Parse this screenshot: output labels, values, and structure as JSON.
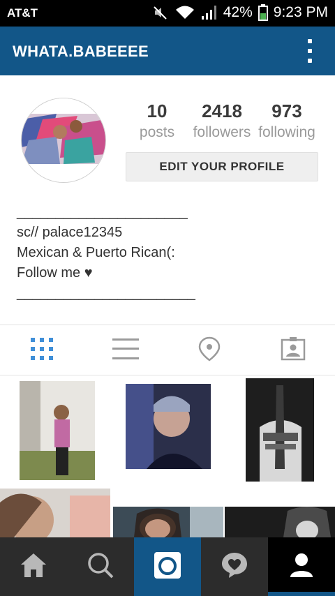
{
  "status_bar": {
    "carrier": "AT&T",
    "battery": "42%",
    "time": "9:23 PM"
  },
  "app_bar": {
    "title": "WHATA.BABEEEE",
    "menu_icon": "overflow-menu-icon",
    "color": "#125688"
  },
  "profile": {
    "stats": [
      {
        "value": "10",
        "label": "posts"
      },
      {
        "value": "2418",
        "label": "followers"
      },
      {
        "value": "973",
        "label": "following"
      }
    ],
    "edit_button_label": "EDIT YOUR PROFILE",
    "bio": {
      "line1": "______________________",
      "line2": "sc// palace12345",
      "line3": "Mexican & Puerto Rican(:",
      "line4": "Follow me ♥",
      "line5": "_______________________"
    }
  },
  "tabs": [
    {
      "icon": "grid-view-icon",
      "active": true
    },
    {
      "icon": "list-view-icon",
      "active": false
    },
    {
      "icon": "location-pin-icon",
      "active": false
    },
    {
      "icon": "tagged-photos-icon",
      "active": false
    }
  ],
  "bottom_nav": [
    {
      "icon": "home-icon"
    },
    {
      "icon": "search-icon"
    },
    {
      "icon": "camera-icon"
    },
    {
      "icon": "activity-heart-icon"
    },
    {
      "icon": "profile-icon",
      "active": true
    }
  ]
}
